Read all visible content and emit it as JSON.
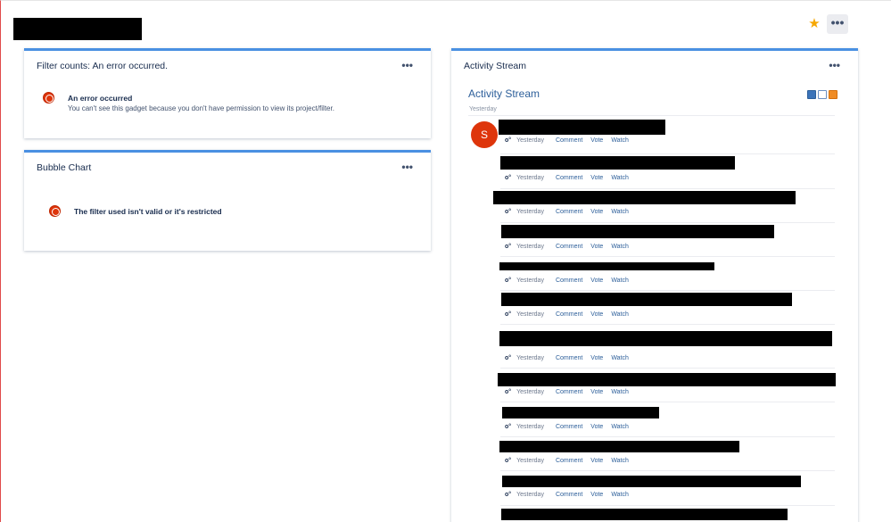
{
  "header": {
    "favourite_icon": "star-icon",
    "more_label": "•••"
  },
  "colors": {
    "accent": "#4a90e2",
    "error": "#de350b",
    "link": "#2d5f9a",
    "star": "#f6a700"
  },
  "filter_counts": {
    "title": "Filter counts: An error occurred.",
    "menu_label": "•••",
    "error_heading": "An error occurred",
    "error_text": "You can't see this gadget because you don't have permission to view its project/filter."
  },
  "bubble_chart": {
    "title": "Bubble Chart",
    "menu_label": "•••",
    "error_text": "The filter used isn't valid or it's restricted"
  },
  "activity_stream": {
    "gadget_title": "Activity Stream",
    "menu_label": "•••",
    "inner_title": "Activity Stream",
    "icons": [
      "full-view-icon",
      "list-view-icon",
      "rss-icon"
    ],
    "group_label": "Yesterday",
    "avatar_letter": "S",
    "entries": [
      {
        "time": "Yesterday",
        "actions": [
          "Comment",
          "Vote",
          "Watch"
        ]
      },
      {
        "time": "Yesterday",
        "actions": [
          "Comment",
          "Vote",
          "Watch"
        ]
      },
      {
        "time": "Yesterday",
        "actions": [
          "Comment",
          "Vote",
          "Watch"
        ]
      },
      {
        "time": "Yesterday",
        "actions": [
          "Comment",
          "Vote",
          "Watch"
        ]
      },
      {
        "time": "Yesterday",
        "actions": [
          "Comment",
          "Vote",
          "Watch"
        ]
      },
      {
        "time": "Yesterday",
        "actions": [
          "Comment",
          "Vote",
          "Watch"
        ]
      },
      {
        "time": "Yesterday",
        "actions": [
          "Comment",
          "Vote",
          "Watch"
        ]
      },
      {
        "time": "Yesterday",
        "actions": [
          "Comment",
          "Vote",
          "Watch"
        ]
      },
      {
        "time": "Yesterday",
        "actions": [
          "Comment",
          "Vote",
          "Watch"
        ]
      },
      {
        "time": "Yesterday",
        "actions": [
          "Comment",
          "Vote",
          "Watch"
        ]
      },
      {
        "time": "Yesterday",
        "actions": [
          "Comment",
          "Vote",
          "Watch"
        ]
      }
    ]
  }
}
